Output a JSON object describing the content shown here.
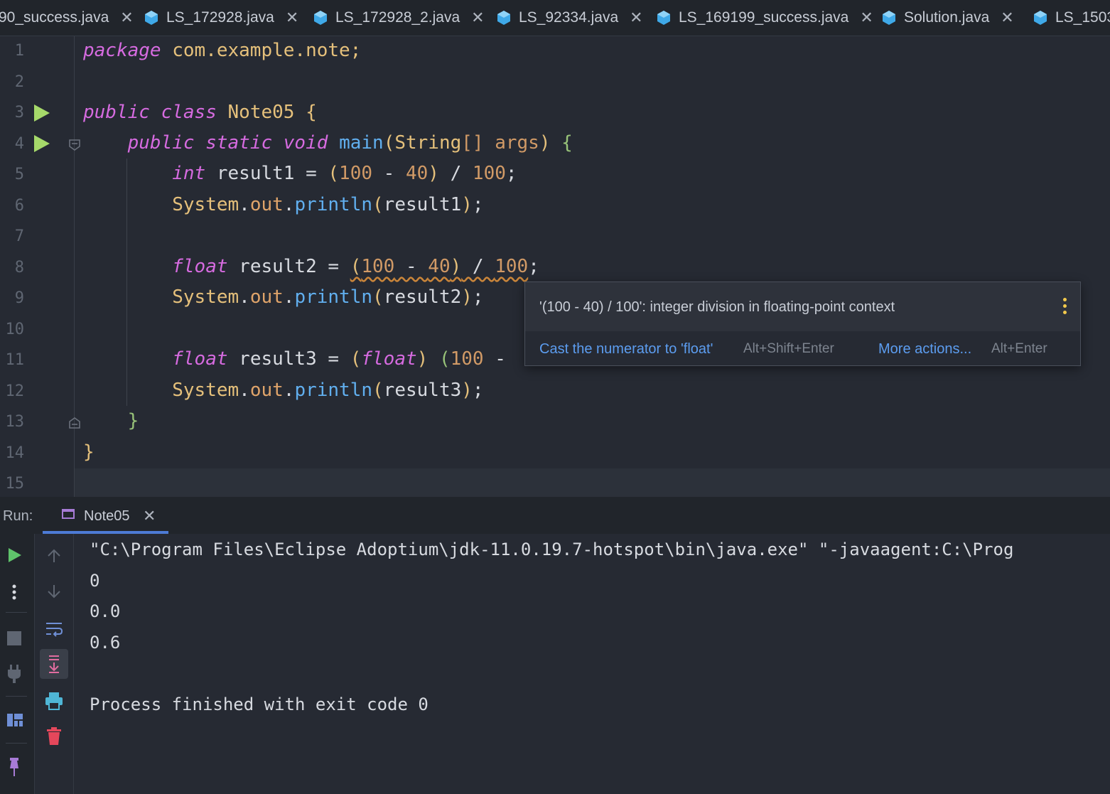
{
  "tabs": [
    {
      "label": "90_success.java"
    },
    {
      "label": "LS_172928.java"
    },
    {
      "label": "LS_172928_2.java"
    },
    {
      "label": "LS_92334.java"
    },
    {
      "label": "LS_169199_success.java"
    },
    {
      "label": "Solution.java"
    },
    {
      "label": "LS_1503"
    }
  ],
  "tab_close_glyph": "✕",
  "editor": {
    "line_numbers": [
      "1",
      "2",
      "3",
      "4",
      "5",
      "6",
      "7",
      "8",
      "9",
      "10",
      "11",
      "12",
      "13",
      "14",
      "15"
    ],
    "lines": {
      "l1": {
        "kw": "package",
        "rest": " com.example.note;"
      },
      "l3": {
        "kw1": "public",
        "kw2": "class",
        "name": "Note05",
        "brace": "{"
      },
      "l4": {
        "kw1": "public",
        "kw2": "static",
        "kw3": "void",
        "fn": "main",
        "p1": "(",
        "type": "String",
        "arr": "[] args",
        "p2": ")",
        "brace": "{"
      },
      "l5": {
        "kw": "int",
        "var": " result1 = ",
        "p1": "(",
        "n1": "100",
        "op": " - ",
        "n2": "40",
        "p2": ")",
        "div": " / ",
        "n3": "100",
        "end": ";"
      },
      "l6": {
        "cls": "System",
        "dot1": ".",
        "fld": "out",
        "dot2": ".",
        "fn": "println",
        "p1": "(",
        "arg": "result1",
        "p2": ")",
        "end": ";"
      },
      "l8": {
        "kw": "float",
        "var": " result2 = ",
        "expr_p1": "(",
        "n1": "100",
        "op": " - ",
        "n2": "40",
        "expr_p2": ")",
        "div": " / ",
        "n3": "100",
        "end": ";"
      },
      "l9": {
        "cls": "System",
        "dot1": ".",
        "fld": "out",
        "dot2": ".",
        "fn": "println",
        "p1": "(",
        "arg": "result2",
        "p2": ")",
        "end": ";"
      },
      "l11": {
        "kw": "float",
        "var": " result3 = ",
        "c1": "(",
        "ckw": "float",
        "c2": ")",
        "sp": " ",
        "p1": "(",
        "n1": "100",
        "op": " -"
      },
      "l12": {
        "cls": "System",
        "dot1": ".",
        "fld": "out",
        "dot2": ".",
        "fn": "println",
        "p1": "(",
        "arg": "result3",
        "p2": ")",
        "end": ";"
      },
      "l13": {
        "brace": "}"
      },
      "l14": {
        "brace": "}"
      }
    }
  },
  "inspection_popup": {
    "message": "'(100 - 40) / 100': integer division in floating-point context",
    "action": "Cast the numerator to 'float'",
    "action_shortcut": "Alt+Shift+Enter",
    "more": "More actions...",
    "more_shortcut": "Alt+Enter"
  },
  "run_panel": {
    "label": "Run:",
    "tab_label": "Note05",
    "tab_close": "✕",
    "output": [
      "\"C:\\Program Files\\Eclipse Adoptium\\jdk-11.0.19.7-hotspot\\bin\\java.exe\" \"-javaagent:C:\\Prog",
      "0",
      "0.0",
      "0.6",
      "",
      "Process finished with exit code 0"
    ]
  },
  "colors": {
    "background": "#262A33",
    "keyword": "#D66BE0",
    "class": "#E5C07B",
    "number": "#D19A66",
    "function": "#61AFEF",
    "run_green": "#A6D96A",
    "link": "#5C9DF0",
    "warning_dots": "#F2C94C"
  }
}
